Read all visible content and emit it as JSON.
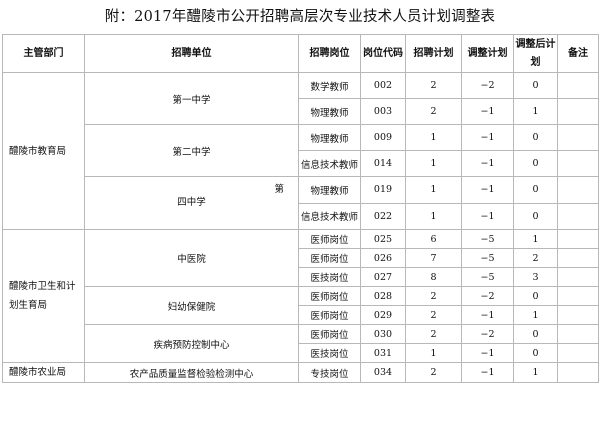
{
  "title": "附：2017年醴陵市公开招聘高层次专业技术人员计划调整表",
  "headers": {
    "dept": "主管部门",
    "unit": "招聘单位",
    "post": "招聘岗位",
    "code": "岗位代码",
    "plan": "招聘计划",
    "adjust": "调整计划",
    "after": "调整后计划",
    "note": "备注"
  },
  "departments": [
    {
      "name": "醴陵市教育局"
    },
    {
      "name": "醴陵市卫生和计划生育局"
    },
    {
      "name": "醴陵市农业局"
    }
  ],
  "units": [
    {
      "name": "第一中学"
    },
    {
      "name": "第二中学"
    },
    {
      "name": "四中学",
      "side_mark": "第"
    },
    {
      "name": "中医院"
    },
    {
      "name": "妇幼保健院"
    },
    {
      "name": "疾病预防控制中心"
    },
    {
      "name": "农产品质量监督检验检测中心"
    }
  ],
  "rows": [
    {
      "post": "数学教师",
      "code": "002",
      "plan": "2",
      "adjust": "−2",
      "after": "0",
      "note": ""
    },
    {
      "post": "物理教师",
      "code": "003",
      "plan": "2",
      "adjust": "−1",
      "after": "1",
      "note": ""
    },
    {
      "post": "物理教师",
      "code": "009",
      "plan": "1",
      "adjust": "−1",
      "after": "0",
      "note": ""
    },
    {
      "post": "信息技术教师",
      "code": "014",
      "plan": "1",
      "adjust": "−1",
      "after": "0",
      "note": ""
    },
    {
      "post": "物理教师",
      "code": "019",
      "plan": "1",
      "adjust": "−1",
      "after": "0",
      "note": ""
    },
    {
      "post": "信息技术教师",
      "code": "022",
      "plan": "1",
      "adjust": "−1",
      "after": "0",
      "note": ""
    },
    {
      "post": "医师岗位",
      "code": "025",
      "plan": "6",
      "adjust": "−5",
      "after": "1",
      "note": ""
    },
    {
      "post": "医师岗位",
      "code": "026",
      "plan": "7",
      "adjust": "−5",
      "after": "2",
      "note": ""
    },
    {
      "post": "医技岗位",
      "code": "027",
      "plan": "8",
      "adjust": "−5",
      "after": "3",
      "note": ""
    },
    {
      "post": "医师岗位",
      "code": "028",
      "plan": "2",
      "adjust": "−2",
      "after": "0",
      "note": ""
    },
    {
      "post": "医师岗位",
      "code": "029",
      "plan": "2",
      "adjust": "−1",
      "after": "1",
      "note": ""
    },
    {
      "post": "医师岗位",
      "code": "030",
      "plan": "2",
      "adjust": "−2",
      "after": "0",
      "note": ""
    },
    {
      "post": "医技岗位",
      "code": "031",
      "plan": "1",
      "adjust": "−1",
      "after": "0",
      "note": ""
    },
    {
      "post": "专技岗位",
      "code": "034",
      "plan": "2",
      "adjust": "−1",
      "after": "1",
      "note": ""
    }
  ]
}
